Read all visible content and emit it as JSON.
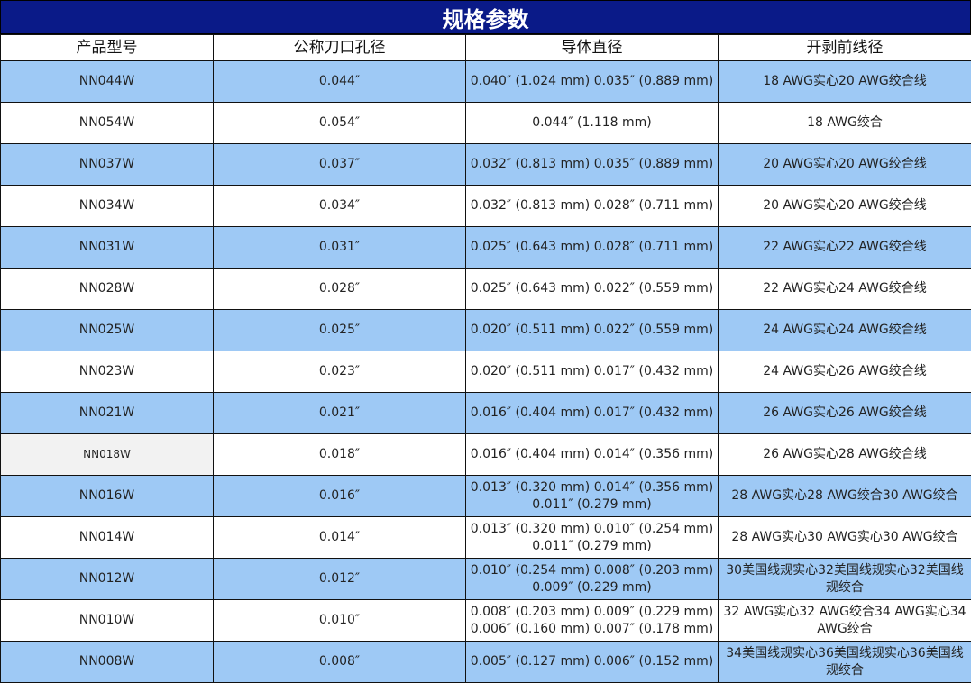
{
  "title": "规格参数",
  "headers": [
    "产品型号",
    "公称刀口孔径",
    "导体直径",
    "开剥前线径"
  ],
  "rows": [
    {
      "model": "NN044W",
      "nominal": "0.044″",
      "conductor": "0.040″ (1.024 mm) 0.035″ (0.889 mm)",
      "wire": "18 AWG实心20 AWG绞合线"
    },
    {
      "model": "NN054W",
      "nominal": "0.054″",
      "conductor": "0.044″ (1.118 mm)",
      "wire": "18 AWG绞合"
    },
    {
      "model": "NN037W",
      "nominal": "0.037″",
      "conductor": "0.032″ (0.813 mm) 0.035″ (0.889 mm)",
      "wire": "20 AWG实心20 AWG绞合线"
    },
    {
      "model": "NN034W",
      "nominal": "0.034″",
      "conductor": "0.032″ (0.813 mm) 0.028″ (0.711 mm)",
      "wire": "20 AWG实心20 AWG绞合线"
    },
    {
      "model": "NN031W",
      "nominal": "0.031″",
      "conductor": "0.025″ (0.643 mm) 0.028″ (0.711 mm)",
      "wire": "22 AWG实心22 AWG绞合线"
    },
    {
      "model": "NN028W",
      "nominal": "0.028″",
      "conductor": "0.025″ (0.643 mm) 0.022″ (0.559 mm)",
      "wire": "22 AWG实心24 AWG绞合线"
    },
    {
      "model": "NN025W",
      "nominal": "0.025″",
      "conductor": "0.020″ (0.511 mm) 0.022″ (0.559 mm)",
      "wire": "24 AWG实心24 AWG绞合线"
    },
    {
      "model": "NN023W",
      "nominal": "0.023″",
      "conductor": "0.020″ (0.511 mm) 0.017″ (0.432 mm)",
      "wire": "24 AWG实心26 AWG绞合线"
    },
    {
      "model": "NN021W",
      "nominal": "0.021″",
      "conductor": "0.016″ (0.404 mm) 0.017″ (0.432 mm)",
      "wire": "26 AWG实心26 AWG绞合线"
    },
    {
      "model": "NN018W",
      "nominal": "0.018″",
      "conductor": "0.016″ (0.404 mm) 0.014″ (0.356 mm)",
      "wire": "26 AWG实心28 AWG绞合线"
    },
    {
      "model": "NN016W",
      "nominal": "0.016″",
      "conductor": "0.013″ (0.320 mm) 0.014″ (0.356 mm) 0.011″ (0.279 mm)",
      "wire": "28 AWG实心28 AWG绞合30 AWG绞合"
    },
    {
      "model": "NN014W",
      "nominal": "0.014″",
      "conductor": "0.013″ (0.320 mm) 0.010″ (0.254 mm) 0.011″ (0.279 mm)",
      "wire": "28 AWG实心30 AWG实心30 AWG绞合"
    },
    {
      "model": "NN012W",
      "nominal": "0.012″",
      "conductor": "0.010″ (0.254 mm) 0.008″ (0.203 mm) 0.009″ (0.229 mm)",
      "wire": "30美国线规实心32美国线规实心32美国线规绞合"
    },
    {
      "model": "NN010W",
      "nominal": "0.010″",
      "conductor": "0.008″ (0.203 mm) 0.009″ (0.229 mm) 0.006″ (0.160 mm) 0.007″ (0.178 mm)",
      "wire": "32 AWG实心32 AWG绞合34 AWG实心34 AWG绞合"
    },
    {
      "model": "NN008W",
      "nominal": "0.008″",
      "conductor": "0.005″ (0.127 mm) 0.006″ (0.152 mm)",
      "wire": "34美国线规实心36美国线规实心36美国线规绞合"
    }
  ],
  "colors": {
    "title_bg": "#0a1a88",
    "row_blue": "#9ec9f5",
    "row_white": "#ffffff",
    "highlight_cell": "#f2f2f2"
  }
}
